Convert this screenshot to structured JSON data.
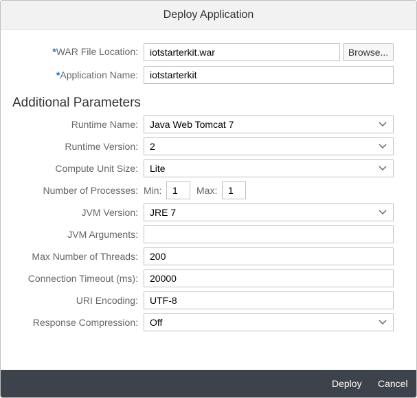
{
  "dialog": {
    "title": "Deploy Application"
  },
  "war_file": {
    "label": "WAR File Location:",
    "value": "iotstarterkit.war",
    "browse_label": "Browse..."
  },
  "app_name": {
    "label": "Application Name:",
    "value": "iotstarterkit"
  },
  "additional": {
    "title": "Additional Parameters",
    "runtime_name": {
      "label": "Runtime Name:",
      "value": "Java Web Tomcat 7"
    },
    "runtime_version": {
      "label": "Runtime Version:",
      "value": "2"
    },
    "compute_unit": {
      "label": "Compute Unit Size:",
      "value": "Lite"
    },
    "processes": {
      "label": "Number of Processes:",
      "min_label": "Min:",
      "min_value": "1",
      "max_label": "Max:",
      "max_value": "1"
    },
    "jvm_version": {
      "label": "JVM Version:",
      "value": "JRE 7"
    },
    "jvm_args": {
      "label": "JVM Arguments:",
      "value": ""
    },
    "max_threads": {
      "label": "Max Number of Threads:",
      "value": "200"
    },
    "conn_timeout": {
      "label": "Connection Timeout (ms):",
      "value": "20000"
    },
    "uri_encoding": {
      "label": "URI Encoding:",
      "value": "UTF-8"
    },
    "response_compression": {
      "label": "Response Compression:",
      "value": "Off"
    }
  },
  "footer": {
    "deploy_label": "Deploy",
    "cancel_label": "Cancel"
  },
  "colors": {
    "required_marker": "#0a6ed1",
    "footer_bg": "#3d434a",
    "header_bg": "#f2f2f2"
  },
  "icons": {
    "select": "chevron-down-icon"
  }
}
